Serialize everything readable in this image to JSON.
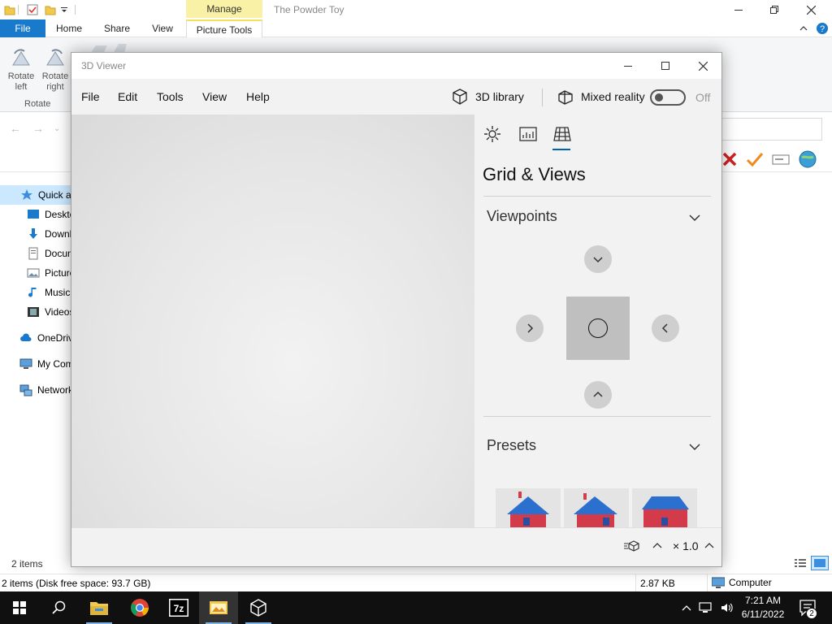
{
  "explorer": {
    "title": "The Powder Toy",
    "manage_tab": "Manage",
    "tabs": {
      "file": "File",
      "home": "Home",
      "share": "Share",
      "view": "View",
      "picture_tools": "Picture Tools"
    },
    "ribbon": {
      "rotate_left": "Rotate left",
      "rotate_right": "Rotate right",
      "group_label": "Rotate"
    },
    "nav_items": [
      "Quick ac",
      "Deskto",
      "Downl",
      "Docum",
      "Picture",
      "Music",
      "Videos",
      "OneDriv",
      "My Com",
      "Network"
    ],
    "item_count": "2 items",
    "status": {
      "left": "2 items (Disk free space: 93.7 GB)",
      "size": "2.87 KB",
      "location": "Computer"
    }
  },
  "viewer": {
    "title": "3D Viewer",
    "menu": {
      "file": "File",
      "edit": "Edit",
      "tools": "Tools",
      "view": "View",
      "help": "Help"
    },
    "library_label": "3D library",
    "mixed_reality_label": "Mixed reality",
    "toggle_state": "Off",
    "panel": {
      "heading": "Grid & Views",
      "viewpoints_label": "Viewpoints",
      "presets_label": "Presets"
    },
    "speed_label": "× 1.0"
  },
  "taskbar": {
    "time": "7:21 AM",
    "date": "6/11/2022",
    "notification_count": "2",
    "apps": [
      "windows-start",
      "search",
      "file-explorer",
      "chrome",
      "7zip",
      "photos",
      "3d-viewer"
    ]
  },
  "colors": {
    "accent": "#1979ca",
    "manage": "#f9f1a5",
    "taskbar": "#101010",
    "viewer_bg": "#f2f2f2"
  }
}
